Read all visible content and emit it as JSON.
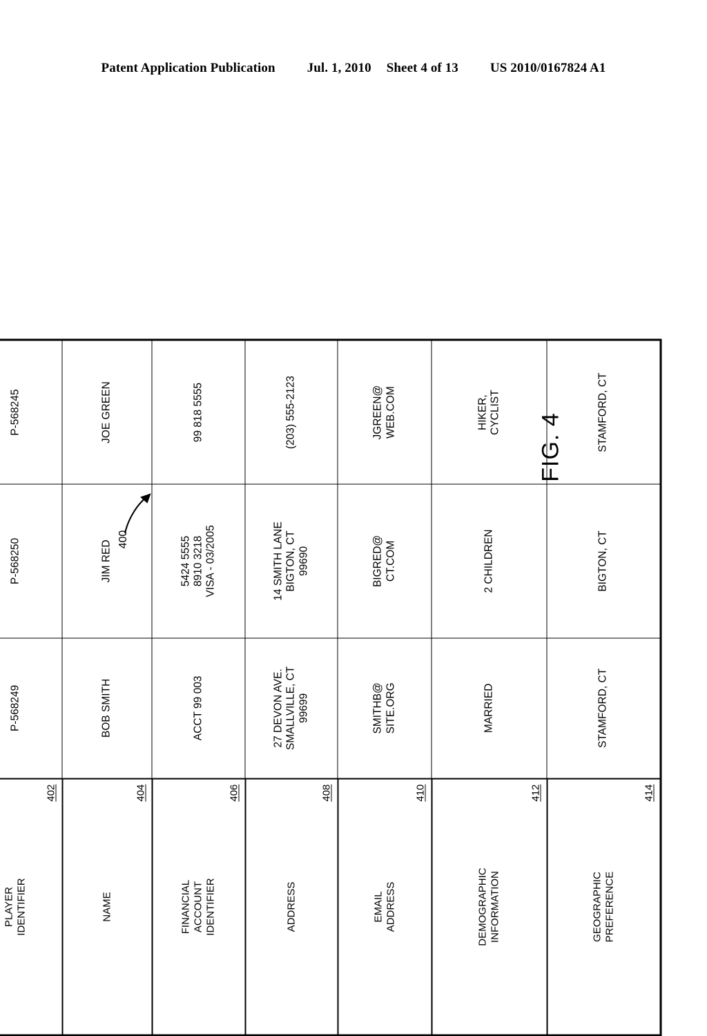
{
  "page_header": {
    "publication": "Patent Application Publication",
    "date": "Jul. 1, 2010",
    "sheet": "Sheet 4 of 13",
    "patent_number": "US 2010/0167824 A1"
  },
  "figure": {
    "caption": "FIG. 4",
    "reference_numeral": "400"
  },
  "table": {
    "fields": [
      {
        "header": "PLAYER\nIDENTIFIER",
        "numeral": "402",
        "values": [
          "P-568249",
          "P-568250",
          "P-568245"
        ]
      },
      {
        "header": "NAME",
        "numeral": "404",
        "values": [
          "BOB SMITH",
          "JIM RED",
          "JOE GREEN"
        ]
      },
      {
        "header": "FINANCIAL\nACCOUNT\nIDENTIFIER",
        "numeral": "406",
        "values": [
          "ACCT 99 003",
          "5424 5555\n8910 3218\nVISA - 03/2005",
          "99 818 5555"
        ]
      },
      {
        "header": "ADDRESS",
        "numeral": "408",
        "values": [
          "27 DEVON AVE.\nSMALLVILLE, CT\n99699",
          "14 SMITH LANE\nBIGTON, CT\n99690",
          "(203) 555-2123"
        ]
      },
      {
        "header": "EMAIL\nADDRESS",
        "numeral": "410",
        "values": [
          "SMITHB@\nSITE.ORG",
          "BIGRED@\nCT.COM",
          "JGREEN@\nWEB.COM"
        ]
      },
      {
        "header": "DEMOGRAPHIC\nINFORMATION",
        "numeral": "412",
        "values": [
          "MARRIED",
          "2 CHILDREN",
          "HIKER,\nCYCLIST"
        ]
      },
      {
        "header": "GEOGRAPHIC\nPREFERENCE",
        "numeral": "414",
        "values": [
          "STAMFORD, CT",
          "BIGTON, CT",
          "STAMFORD, CT"
        ]
      }
    ]
  },
  "colors": {
    "ink": "#000000",
    "paper": "#ffffff"
  }
}
